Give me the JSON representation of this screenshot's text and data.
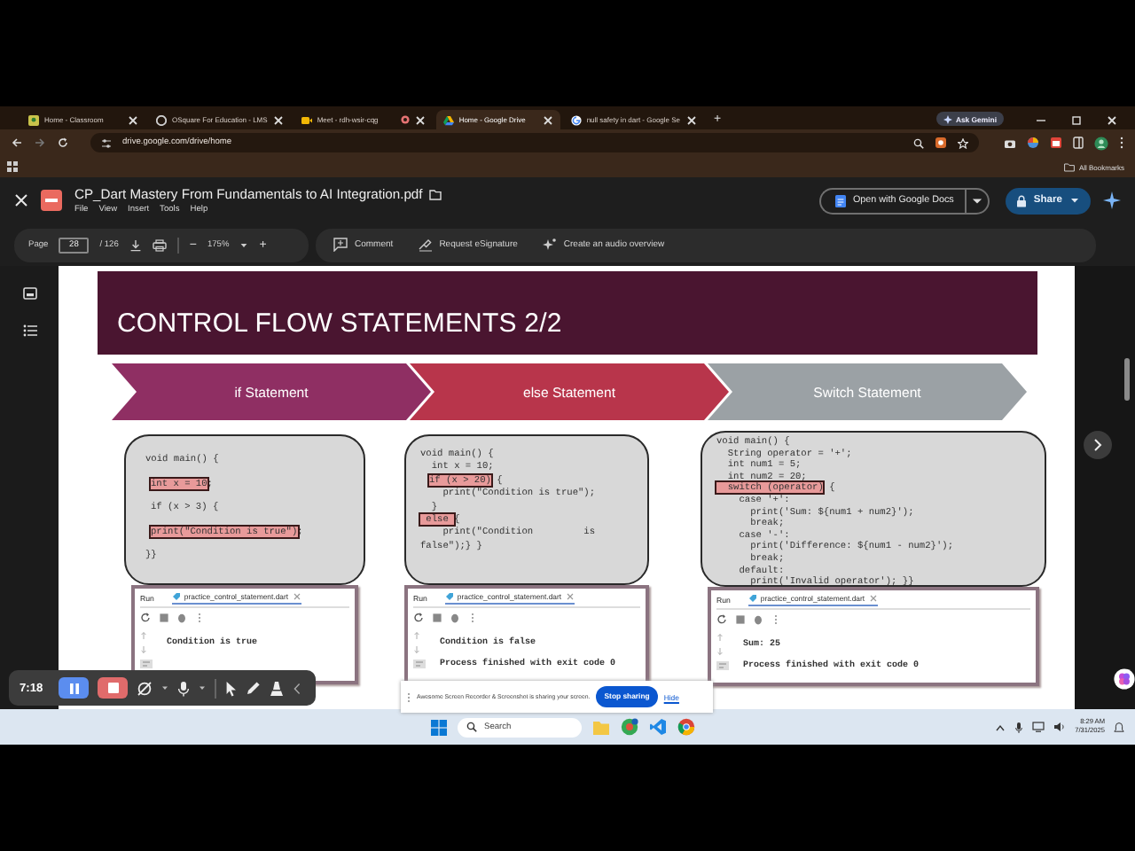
{
  "browser": {
    "tabs": [
      {
        "title": "Home - Classroom",
        "selected": false,
        "kind": "classroom"
      },
      {
        "title": "OSquare For Education - LMS",
        "selected": false,
        "kind": "lms"
      },
      {
        "title": "Meet - rdh-wsir-cqg",
        "selected": false,
        "kind": "meet"
      },
      {
        "title": "Home - Google Drive",
        "selected": true,
        "kind": "drive"
      },
      {
        "title": "null safety in dart - Google Se",
        "selected": false,
        "kind": "search"
      }
    ],
    "new_tab": "+",
    "gemini_button": "Ask Gemini",
    "url": "drive.google.com/drive/home",
    "bookmarks": "All Bookmarks"
  },
  "viewer": {
    "file_name": "CP_Dart Mastery From Fundamentals to AI Integration.pdf",
    "menu": [
      "File",
      "View",
      "Insert",
      "Tools",
      "Help"
    ],
    "open_with": "Open with Google Docs",
    "share": "Share",
    "page_label": "Page",
    "page": "28",
    "page_total": "/ 126",
    "zoom_out": "−",
    "zoom": "175%",
    "zoom_in": "+",
    "actions": [
      "Comment",
      "Request eSignature",
      "Create an audio overview"
    ]
  },
  "slide": {
    "title": "CONTROL FLOW STATEMENTS 2/2",
    "steps": [
      {
        "label": "if Statement",
        "color": "#8f2f63"
      },
      {
        "label": "else Statement",
        "color": "#b8354b"
      },
      {
        "label": "Switch Statement",
        "color": "#9ba1a5"
      }
    ],
    "examples": [
      {
        "code": [
          [
            {
              "text": "void main() {",
              "highlighted": false
            }
          ],
          [
            {
              "text": "int x = 10",
              "highlighted": true
            },
            {
              "text": ";",
              "highlighted": false
            }
          ],
          [
            {
              "text": "if (x > 3) {",
              "highlighted": false
            }
          ],
          [
            {
              "text": "print(\"Condition is true\")",
              "highlighted": true
            },
            {
              "text": ";",
              "highlighted": false
            }
          ],
          [
            {
              "text": "}}",
              "highlighted": false
            }
          ]
        ],
        "run": {
          "label": "Run",
          "tab": "practice_control_statement.dart",
          "output": [
            "Condition is true"
          ]
        }
      },
      {
        "code": [
          [
            {
              "text": "void main() {",
              "highlighted": false
            }
          ],
          [
            {
              "text": "  int x = 10;",
              "highlighted": false
            }
          ],
          [
            {
              "text": "if (x > 20)",
              "highlighted": true
            },
            {
              "text": " {",
              "highlighted": false
            }
          ],
          [
            {
              "text": "    print(\"Condition is true\");",
              "highlighted": false
            }
          ],
          [
            {
              "text": "  }",
              "highlighted": false
            }
          ],
          [
            {
              "text": " else ",
              "highlighted": true
            },
            {
              "text": "{",
              "highlighted": false
            }
          ],
          [
            {
              "text": "    print(\"Condition         is",
              "highlighted": false
            }
          ],
          [
            {
              "text": "false\");} }",
              "highlighted": false
            }
          ]
        ],
        "run": {
          "label": "Run",
          "tab": "practice_control_statement.dart",
          "output": [
            "Condition is false",
            "Process finished with exit code 0"
          ]
        }
      },
      {
        "code": [
          [
            {
              "text": "void main() {",
              "highlighted": false
            }
          ],
          [
            {
              "text": "  String operator = '+';",
              "highlighted": false
            }
          ],
          [
            {
              "text": "  int num1 = 5;",
              "highlighted": false
            }
          ],
          [
            {
              "text": "  int num2 = 20;",
              "highlighted": false
            }
          ],
          [
            {
              "text": "  switch (operator)",
              "highlighted": true
            },
            {
              "text": " {",
              "highlighted": false
            }
          ],
          [
            {
              "text": "    case '+':",
              "highlighted": false
            }
          ],
          [
            {
              "text": "      print('Sum: ${num1 + num2}');",
              "highlighted": false
            }
          ],
          [
            {
              "text": "      break;",
              "highlighted": false
            }
          ],
          [
            {
              "text": "    case '-':",
              "highlighted": false
            }
          ],
          [
            {
              "text": "      print('Difference: ${num1 - num2}');",
              "highlighted": false
            }
          ],
          [
            {
              "text": "      break;",
              "highlighted": false
            }
          ],
          [
            {
              "text": "    default:",
              "highlighted": false
            }
          ],
          [
            {
              "text": "      print('Invalid operator'); }}",
              "highlighted": false
            }
          ]
        ],
        "run": {
          "label": "Run",
          "tab": "practice_control_statement.dart",
          "output": [
            "Sum: 25",
            "Process finished with exit code 0"
          ]
        }
      }
    ]
  },
  "recorder": {
    "time": "7:18"
  },
  "sharing_bar": {
    "message": "Awesome Screen Recorder & Screenshot is sharing your screen.",
    "stop": "Stop sharing",
    "hide": "Hide"
  },
  "taskbar": {
    "search": "Search",
    "time": "8:29 AM",
    "date": "7/31/2025"
  }
}
